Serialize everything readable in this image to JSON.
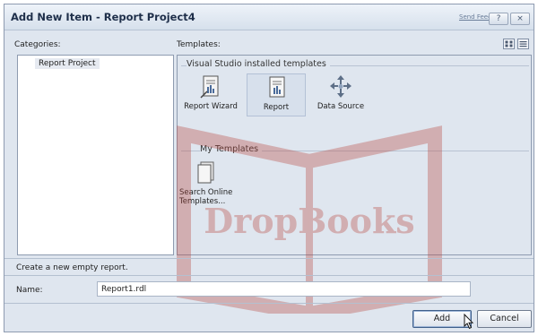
{
  "window": {
    "title": "Add New Item - Report Project4",
    "feedback_link": "Send Feedback",
    "help_button": "?",
    "close_button": "×"
  },
  "categories": {
    "label": "Categories:",
    "items": [
      "Report Project"
    ]
  },
  "templates": {
    "label": "Templates:",
    "installed_group": "Visual Studio installed templates",
    "installed": [
      {
        "label": "Report Wizard",
        "icon": "report-wizard-icon"
      },
      {
        "label": "Report",
        "icon": "report-icon",
        "selected": true
      },
      {
        "label": "Data Source",
        "icon": "data-source-icon"
      }
    ],
    "my_group": "My Templates",
    "my": [
      {
        "label_line1": "Search Online",
        "label_line2": "Templates...",
        "icon": "search-online-templates-icon"
      }
    ]
  },
  "description": "Create a new empty report.",
  "name_field": {
    "label": "Name:",
    "value": "Report1.rdl"
  },
  "buttons": {
    "add": "Add",
    "cancel": "Cancel"
  },
  "watermark": "DropBooks",
  "colors": {
    "dialog_bg": "#dfe6ef",
    "selection_bg": "#d7e0ec",
    "watermark": "#b8483f"
  }
}
